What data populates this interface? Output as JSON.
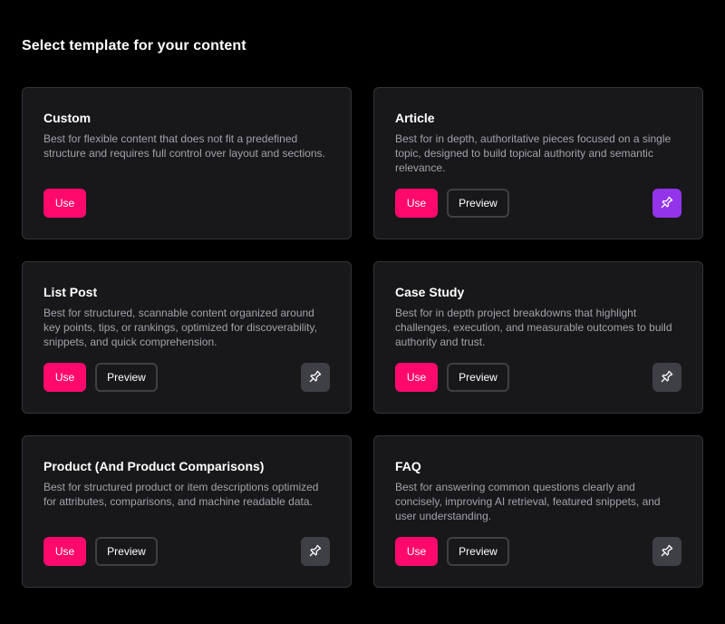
{
  "page": {
    "title": "Select template for your content"
  },
  "colors": {
    "accent": "#ff0a6c",
    "pinned": "#9333ea",
    "card_bg": "#18181b"
  },
  "buttons": {
    "use": "Use",
    "preview": "Preview"
  },
  "templates": [
    {
      "title": "Custom",
      "description": "Best for flexible content that does not fit a predefined structure and requires full control over layout and sections.",
      "has_preview": false,
      "has_pin": false,
      "pinned": false
    },
    {
      "title": "Article",
      "description": "Best for in depth, authoritative pieces focused on a single topic, designed to build topical authority and semantic relevance.",
      "has_preview": true,
      "has_pin": true,
      "pinned": true
    },
    {
      "title": "List Post",
      "description": "Best for structured, scannable content organized around key points, tips, or rankings, optimized for discoverability, snippets, and quick comprehension.",
      "has_preview": true,
      "has_pin": true,
      "pinned": false
    },
    {
      "title": "Case Study",
      "description": "Best for in depth project breakdowns that highlight challenges, execution, and measurable outcomes to build authority and trust.",
      "has_preview": true,
      "has_pin": true,
      "pinned": false
    },
    {
      "title": "Product (And Product Comparisons)",
      "description": "Best for structured product or item descriptions optimized for attributes, comparisons, and machine readable data.",
      "has_preview": true,
      "has_pin": true,
      "pinned": false
    },
    {
      "title": "FAQ",
      "description": "Best for answering common questions clearly and concisely, improving AI retrieval, featured snippets, and user understanding.",
      "has_preview": true,
      "has_pin": true,
      "pinned": false
    }
  ]
}
